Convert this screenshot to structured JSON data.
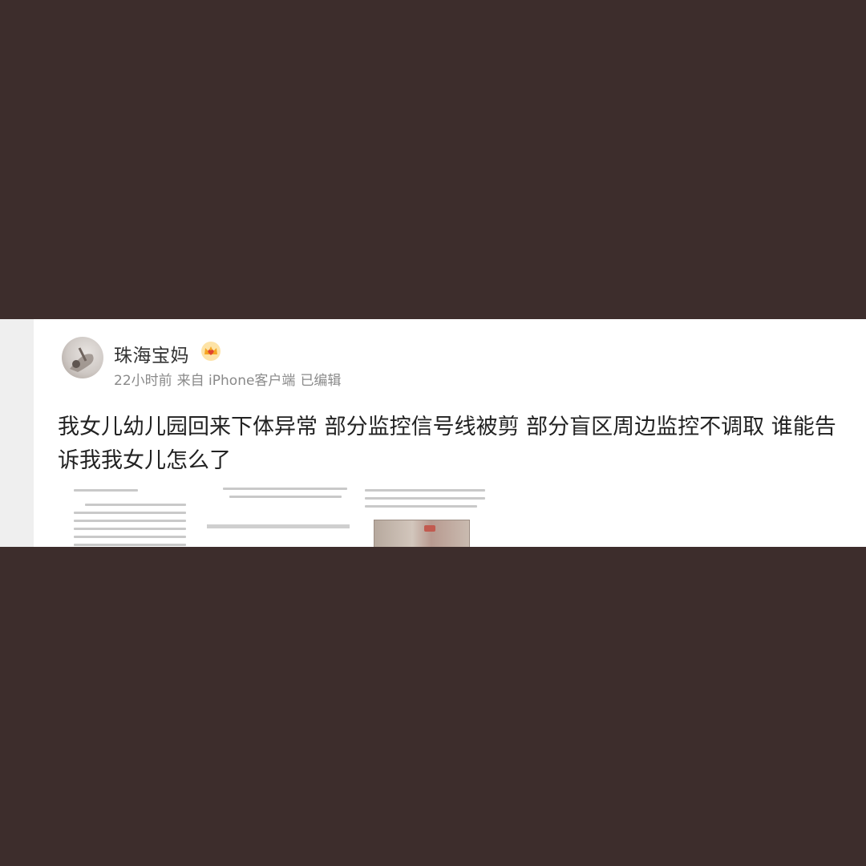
{
  "post": {
    "username": "珠海宝妈",
    "meta": {
      "time": "22小时前",
      "source": "来自 iPhone客户端",
      "edited": "已编辑"
    },
    "text": "我女儿幼儿园回来下体异常 部分监控信号线被剪 部分盲区周边监控不调取 谁能告诉我我女儿怎么了"
  },
  "badge_icon": "crown-icon",
  "colors": {
    "background": "#3d2d2c",
    "card": "#ffffff",
    "meta_text": "#8a8a8a",
    "badge": "#f5a623"
  }
}
